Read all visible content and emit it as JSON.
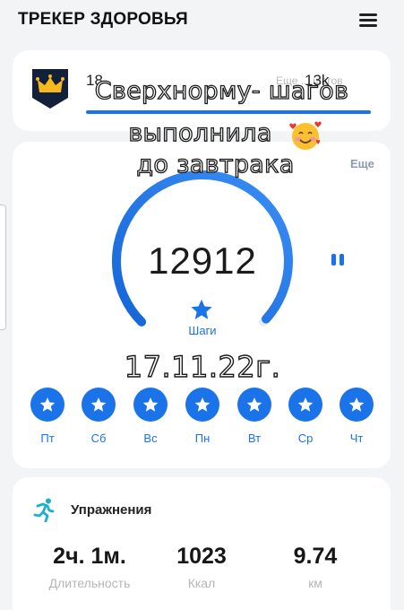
{
  "header": {
    "title": "ТРЕКЕР ЗДОРОВЬЯ",
    "menu_icon": "hamburger-menu-icon"
  },
  "ranking": {
    "rank": "18",
    "goal": "13k",
    "goal_hint": "Еще ... шагов",
    "badge_icon": "crown-badge-icon"
  },
  "steps": {
    "more_label": "Еще",
    "value": "12912",
    "label": "Шаги",
    "progress_fraction": 0.99,
    "accent_color": "#1a73e8"
  },
  "week": {
    "days": [
      "Пт",
      "Сб",
      "Вс",
      "Пн",
      "Вт",
      "Ср",
      "Чт"
    ]
  },
  "exercise": {
    "title": "Упражнения",
    "stats": [
      {
        "value": "2ч. 1м.",
        "label": "Длительность"
      },
      {
        "value": "1023",
        "label": "Ккал"
      },
      {
        "value": "9.74",
        "label": "км"
      }
    ]
  },
  "overlay": {
    "line1": "Сверхнорму- шагов",
    "line2": "выполнила",
    "line3": "до завтрака",
    "date": "17.11.22г.",
    "emoji": "smiling-face-with-hearts-emoji"
  }
}
